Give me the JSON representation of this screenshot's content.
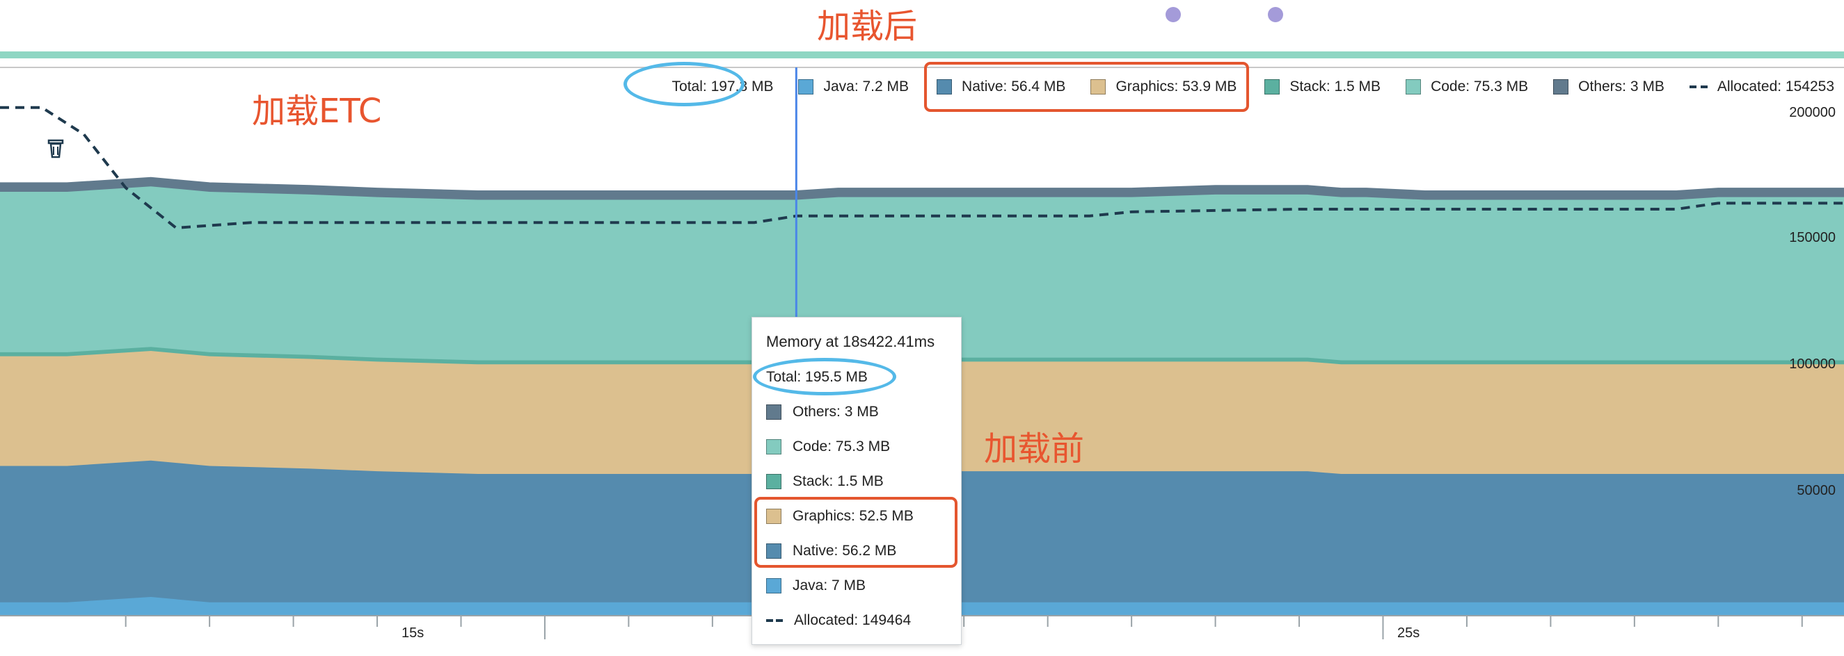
{
  "annotations": {
    "after": "加载后",
    "etc": "加载ETC",
    "before": "加载前"
  },
  "legend": {
    "total": "Total: 197.3 MB",
    "java": "Java: 7.2 MB",
    "native": "Native: 56.4 MB",
    "graphics": "Graphics: 53.9 MB",
    "stack": "Stack: 1.5 MB",
    "code": "Code: 75.3 MB",
    "others": "Others: 3 MB",
    "allocated": "Allocated: 154253"
  },
  "tooltip": {
    "title": "Memory at 18s422.41ms",
    "total": "Total: 195.5 MB",
    "others": "Others: 3 MB",
    "code": "Code: 75.3 MB",
    "stack": "Stack: 1.5 MB",
    "graphics": "Graphics: 52.5 MB",
    "native": "Native: 56.2 MB",
    "java": "Java: 7 MB",
    "allocated": "Allocated: 149464"
  },
  "colors": {
    "java": "#5aa8d6",
    "native": "#558bae",
    "graphics": "#dcc08f",
    "stack": "#5bb0a0",
    "code": "#83cbbf",
    "others": "#617a8d",
    "allocated": "#1f3a4e",
    "cursor": "#4a86e8",
    "top_band": "#8fd6c3",
    "markers": "#a49bd9",
    "highlight_red": "#e4562f",
    "highlight_blue": "#54b9e8"
  },
  "chart_data": {
    "type": "area",
    "stacked": true,
    "x": [
      8.5,
      9.3,
      10.3,
      11.0,
      12.2,
      13.0,
      14.2,
      15.0,
      16.0,
      18.0,
      18.5,
      20.0,
      22.0,
      23.0,
      23.3,
      24.1,
      24.5,
      24.8,
      25.5,
      27.0,
      28.5,
      29.0,
      30.5
    ],
    "series": [
      {
        "name": "Java",
        "values": [
          5,
          5,
          7,
          5,
          5,
          5,
          5,
          5,
          5,
          5,
          5,
          5,
          5,
          5,
          5,
          5,
          5,
          5,
          5,
          5,
          5,
          5,
          5
        ]
      },
      {
        "name": "Native",
        "values": [
          51,
          51,
          51,
          51,
          50,
          49,
          48,
          48,
          48,
          48,
          49,
          49,
          49,
          49,
          49,
          49,
          48,
          48,
          48,
          48,
          48,
          48,
          48
        ]
      },
      {
        "name": "Graphics",
        "values": [
          41,
          41,
          41,
          41,
          41,
          41,
          41,
          41,
          41,
          41,
          41,
          41,
          41,
          41,
          41,
          41,
          41,
          41,
          41,
          41,
          41,
          41,
          41
        ]
      },
      {
        "name": "Stack",
        "values": [
          1.5,
          1.5,
          1.5,
          1.5,
          1.5,
          1.5,
          1.5,
          1.5,
          1.5,
          1.5,
          1.5,
          1.5,
          1.5,
          1.5,
          1.5,
          1.5,
          1.5,
          1.5,
          1.5,
          1.5,
          1.5,
          1.5,
          1.5
        ]
      },
      {
        "name": "Code",
        "values": [
          60,
          60,
          60,
          60,
          60,
          60,
          60,
          60,
          60,
          60,
          60,
          60,
          60,
          61,
          61,
          61,
          61,
          61,
          60,
          60,
          60,
          61,
          61
        ]
      },
      {
        "name": "Others",
        "values": [
          3,
          3,
          3,
          3,
          3,
          3,
          3,
          3,
          3,
          3,
          3,
          3,
          3,
          3,
          3,
          3,
          3,
          3,
          3,
          3,
          3,
          3,
          3
        ]
      }
    ],
    "allocated": {
      "name": "Allocated",
      "x": [
        8.5,
        9.0,
        9.5,
        10.0,
        10.6,
        11.5,
        12.5,
        14.0,
        16.0,
        17.5,
        18.0,
        20.0,
        21.5,
        22.0,
        24.0,
        25.0,
        27.0,
        28.5,
        29.0,
        30.5
      ],
      "values": [
        190000,
        190000,
        180000,
        160000,
        145000,
        147000,
        147000,
        147000,
        147000,
        147000,
        149464,
        149464,
        149464,
        151000,
        152000,
        152000,
        152000,
        152000,
        154253,
        154253
      ]
    },
    "yticks": [
      "200000",
      "150000",
      "100000",
      "50000"
    ],
    "ytick_values": [
      200000,
      150000,
      100000,
      50000
    ],
    "xticks": [
      "15s",
      "25s"
    ],
    "xtick_values": [
      15,
      25
    ],
    "ylim": [
      0,
      205000
    ],
    "xlim": [
      8.5,
      30.5
    ],
    "cursor_x": 18.0,
    "grid": false,
    "legend_position": "top-right"
  }
}
